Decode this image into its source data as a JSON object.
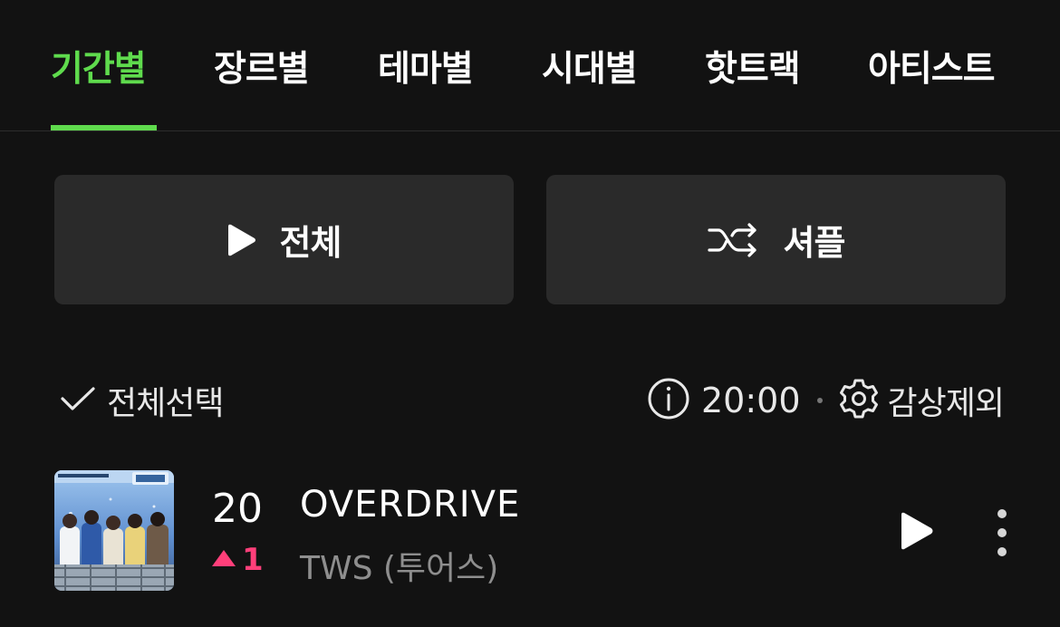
{
  "tabs": [
    {
      "label": "기간별",
      "active": true
    },
    {
      "label": "장르별",
      "active": false
    },
    {
      "label": "테마별",
      "active": false
    },
    {
      "label": "시대별",
      "active": false
    },
    {
      "label": "핫트랙",
      "active": false
    },
    {
      "label": "아티스트",
      "active": false
    }
  ],
  "actions": {
    "play_all_label": "전체",
    "shuffle_label": "셔플"
  },
  "list_header": {
    "select_all_label": "전체선택",
    "update_time": "20:00",
    "exclude_label": "감상제외"
  },
  "tracks": [
    {
      "rank": "20",
      "change_direction": "up",
      "change_value": "1",
      "title": "OVERDRIVE",
      "artist": "TWS (투어스)"
    }
  ],
  "colors": {
    "accent": "#5fdb4d",
    "rank_up": "#ff3f7a",
    "background": "#121212",
    "button_bg": "#2a2a2a"
  }
}
